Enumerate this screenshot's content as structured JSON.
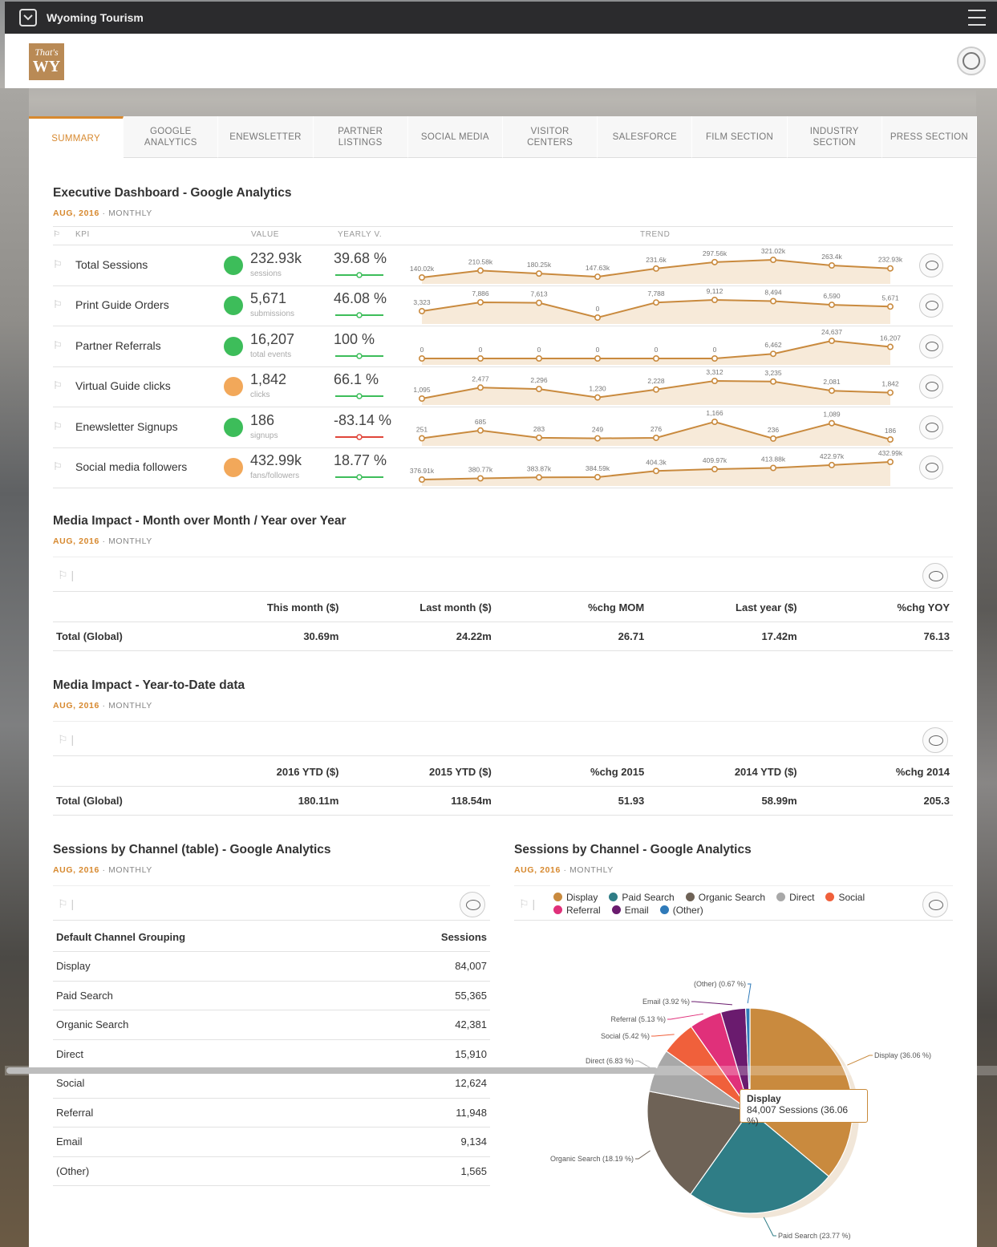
{
  "app": {
    "title": "Wyoming Tourism",
    "logo_line1": "That's",
    "logo_line2": "WY"
  },
  "tabs": [
    {
      "label": "SUMMARY",
      "active": true
    },
    {
      "label": "GOOGLE ANALYTICS"
    },
    {
      "label": "ENEWSLETTER"
    },
    {
      "label": "PARTNER LISTINGS"
    },
    {
      "label": "SOCIAL MEDIA"
    },
    {
      "label": "VISITOR CENTERS"
    },
    {
      "label": "SALESFORCE"
    },
    {
      "label": "FILM SECTION"
    },
    {
      "label": "INDUSTRY SECTION"
    },
    {
      "label": "PRESS SECTION"
    }
  ],
  "exec": {
    "title": "Executive Dashboard - Google Analytics",
    "date": "AUG, 2016",
    "period": "MONTHLY",
    "headers": {
      "kpi": "KPI",
      "value": "VALUE",
      "yearly": "YEARLY V.",
      "trend": "TREND"
    },
    "rows": [
      {
        "name": "Total Sessions",
        "value": "232.93k",
        "unit": "sessions",
        "yoy": "39.68 %",
        "status": "#3dbd5a",
        "mini": "#3dbd5a",
        "trend": [
          140.02,
          210.58,
          180.25,
          147.63,
          231.6,
          297.56,
          321.02,
          263.4,
          232.93
        ],
        "labels": [
          "140.02k",
          "210.58k",
          "180.25k",
          "147.63k",
          "231.6k",
          "297.56k",
          "321.02k",
          "263.4k",
          "232.93k"
        ]
      },
      {
        "name": "Print Guide Orders",
        "value": "5,671",
        "unit": "submissions",
        "yoy": "46.08 %",
        "status": "#3dbd5a",
        "mini": "#3dbd5a",
        "trend": [
          3323,
          7886,
          7613,
          0,
          7788,
          9112,
          8494,
          6590,
          5671
        ],
        "labels": [
          "3,323",
          "7,886",
          "7,613",
          "0",
          "7,788",
          "9,112",
          "8,494",
          "6,590",
          "5,671"
        ]
      },
      {
        "name": "Partner Referrals",
        "value": "16,207",
        "unit": "total events",
        "yoy": "100 %",
        "status": "#3dbd5a",
        "mini": "#3dbd5a",
        "trend": [
          0,
          0,
          0,
          0,
          0,
          0,
          6462,
          24637,
          16207
        ],
        "labels": [
          "0",
          "0",
          "0",
          "0",
          "0",
          "0",
          "6,462",
          "24,637",
          "16,207"
        ]
      },
      {
        "name": "Virtual Guide clicks",
        "value": "1,842",
        "unit": "clicks",
        "yoy": "66.1 %",
        "status": "#f2a85a",
        "mini": "#3dbd5a",
        "trend": [
          1095,
          2477,
          2296,
          1230,
          2228,
          3312,
          3235,
          2081,
          1842
        ],
        "labels": [
          "1,095",
          "2,477",
          "2,296",
          "1,230",
          "2,228",
          "3,312",
          "3,235",
          "2,081",
          "1,842"
        ]
      },
      {
        "name": "Enewsletter Signups",
        "value": "186",
        "unit": "signups",
        "yoy": "-83.14 %",
        "status": "#3dbd5a",
        "mini": "#e0463a",
        "trend": [
          251,
          685,
          283,
          249,
          276,
          1166,
          236,
          1089,
          186
        ],
        "labels": [
          "251",
          "685",
          "283",
          "249",
          "276",
          "1,166",
          "236",
          "1,089",
          "186"
        ]
      },
      {
        "name": "Social media followers",
        "value": "432.99k",
        "unit": "fans/followers",
        "yoy": "18.77 %",
        "status": "#f2a85a",
        "mini": "#3dbd5a",
        "trend": [
          376.91,
          380.77,
          383.87,
          384.59,
          404.3,
          409.97,
          413.88,
          422.97,
          432.99
        ],
        "labels": [
          "376.91k",
          "380.77k",
          "383.87k",
          "384.59k",
          "404.3k",
          "409.97k",
          "413.88k",
          "422.97k",
          "432.99k"
        ]
      }
    ]
  },
  "mom": {
    "title": "Media Impact - Month over Month / Year over Year",
    "date": "AUG, 2016",
    "period": "MONTHLY",
    "cols": [
      "This month ($)",
      "Last month ($)",
      "%chg MOM",
      "Last year ($)",
      "%chg YOY"
    ],
    "row": {
      "label": "Total (Global)",
      "values": [
        "30.69m",
        "24.22m",
        "26.71",
        "17.42m",
        "76.13"
      ]
    }
  },
  "ytd": {
    "title": "Media Impact - Year-to-Date data",
    "date": "AUG, 2016",
    "period": "MONTHLY",
    "cols": [
      "2016 YTD ($)",
      "2015 YTD ($)",
      "%chg 2015",
      "2014 YTD ($)",
      "%chg 2014"
    ],
    "row": {
      "label": "Total (Global)",
      "values": [
        "180.11m",
        "118.54m",
        "51.93",
        "58.99m",
        "205.3"
      ]
    }
  },
  "channel_table": {
    "title": "Sessions by Channel (table) - Google Analytics",
    "date": "AUG, 2016",
    "period": "MONTHLY",
    "col1": "Default Channel Grouping",
    "col2": "Sessions",
    "rows": [
      {
        "label": "Display",
        "value": "84,007"
      },
      {
        "label": "Paid Search",
        "value": "55,365"
      },
      {
        "label": "Organic Search",
        "value": "42,381"
      },
      {
        "label": "Direct",
        "value": "15,910"
      },
      {
        "label": "Social",
        "value": "12,624"
      },
      {
        "label": "Referral",
        "value": "11,948"
      },
      {
        "label": "Email",
        "value": "9,134"
      },
      {
        "label": "(Other)",
        "value": "1,565"
      }
    ]
  },
  "channel_chart": {
    "title": "Sessions by Channel - Google Analytics",
    "date": "AUG, 2016",
    "period": "MONTHLY",
    "tooltip": {
      "title": "Display",
      "text": "84,007 Sessions (36.06 %)"
    }
  },
  "chart_data": {
    "type": "pie",
    "series": [
      {
        "values": [
          36.06,
          23.77,
          18.19,
          6.83,
          5.42,
          5.13,
          3.92,
          0.67
        ]
      }
    ],
    "categories": [
      "Display",
      "Paid Search",
      "Organic Search",
      "Direct",
      "Social",
      "Referral",
      "Email",
      "(Other)"
    ],
    "slice_labels": [
      "Display (36.06 %)",
      "Paid Search (23.77 %)",
      "Organic Search (18.19 %)",
      "Direct (6.83 %)",
      "Social (5.42 %)",
      "Referral (5.13 %)",
      "Email (3.92 %)",
      "(Other) (0.67 %)"
    ],
    "colors": [
      "#c98a3e",
      "#2f7d86",
      "#6e6256",
      "#a8a8a8",
      "#f0603b",
      "#e0307a",
      "#6a1b6e",
      "#2f7ab9"
    ],
    "legend_placement": "top"
  }
}
